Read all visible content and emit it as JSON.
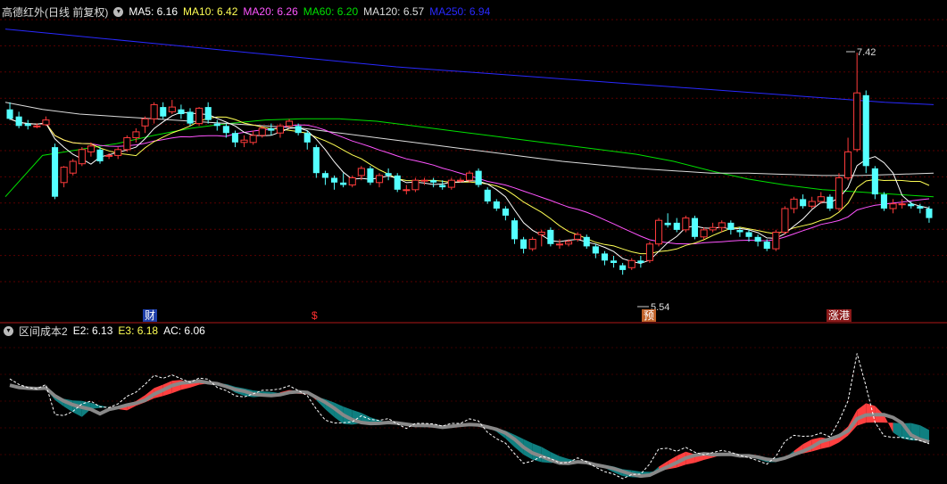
{
  "header": {
    "title": "高德红外(日线 前复权)",
    "ma": [
      {
        "label": "MA5: 6.16",
        "color": "#ffffff"
      },
      {
        "label": "MA10: 6.42",
        "color": "#ffff54"
      },
      {
        "label": "MA20: 6.26",
        "color": "#ff54ff"
      },
      {
        "label": "MA60: 6.20",
        "color": "#00e000"
      },
      {
        "label": "MA120: 6.57",
        "color": "#dddddd"
      },
      {
        "label": "MA250: 6.94",
        "color": "#2929ff"
      }
    ]
  },
  "indicator_header": {
    "title": "区间成本2",
    "items": [
      {
        "label": "E2: 6.13",
        "color": "#ffffff"
      },
      {
        "label": "E3: 6.18",
        "color": "#ffff54"
      },
      {
        "label": "AC: 6.06",
        "color": "#ffffff"
      }
    ]
  },
  "annotations": {
    "high": "7.42",
    "low": "5.54"
  },
  "markers": [
    {
      "text": "财",
      "bg": "#1f3fa8",
      "color": "#ffffff"
    },
    {
      "text": "$",
      "bg": "#000000",
      "color": "#ff3030"
    },
    {
      "text": "预",
      "bg": "#c0632a",
      "color": "#ffffff"
    },
    {
      "text": "涨港",
      "bg": "#8b1a1a",
      "color": "#ffffff"
    }
  ],
  "chart_data": {
    "type": "candlestick",
    "price_range": [
      5.3,
      7.7
    ],
    "candles": [
      [
        6.94,
        6.86,
        7.0,
        6.85
      ],
      [
        6.88,
        6.8,
        6.92,
        6.78
      ],
      [
        6.82,
        6.8,
        6.85,
        6.77
      ],
      [
        6.8,
        6.8,
        6.82,
        6.78
      ],
      [
        6.81,
        6.85,
        6.88,
        6.8
      ],
      [
        6.62,
        6.2,
        6.65,
        6.18
      ],
      [
        6.32,
        6.45,
        6.46,
        6.28
      ],
      [
        6.4,
        6.5,
        6.52,
        6.38
      ],
      [
        6.48,
        6.6,
        6.62,
        6.46
      ],
      [
        6.58,
        6.63,
        6.66,
        6.54
      ],
      [
        6.6,
        6.5,
        6.62,
        6.48
      ],
      [
        6.55,
        6.55,
        6.57,
        6.52
      ],
      [
        6.55,
        6.6,
        6.62,
        6.52
      ],
      [
        6.6,
        6.7,
        6.72,
        6.58
      ],
      [
        6.7,
        6.75,
        6.78,
        6.66
      ],
      [
        6.8,
        6.86,
        6.88,
        6.74
      ],
      [
        6.86,
        6.98,
        7.0,
        6.82
      ],
      [
        6.96,
        6.88,
        7.0,
        6.86
      ],
      [
        6.92,
        6.96,
        7.02,
        6.9
      ],
      [
        6.94,
        6.9,
        6.98,
        6.86
      ],
      [
        6.92,
        6.82,
        6.95,
        6.8
      ],
      [
        6.82,
        6.95,
        6.96,
        6.8
      ],
      [
        6.96,
        6.85,
        7.0,
        6.82
      ],
      [
        6.82,
        6.8,
        6.85,
        6.76
      ],
      [
        6.8,
        6.74,
        6.82,
        6.7
      ],
      [
        6.74,
        6.66,
        6.76,
        6.62
      ],
      [
        6.66,
        6.68,
        6.72,
        6.62
      ],
      [
        6.66,
        6.72,
        6.76,
        6.64
      ],
      [
        6.72,
        6.78,
        6.8,
        6.7
      ],
      [
        6.78,
        6.76,
        6.82,
        6.72
      ],
      [
        6.74,
        6.8,
        6.82,
        6.7
      ],
      [
        6.8,
        6.84,
        6.86,
        6.78
      ],
      [
        6.8,
        6.74,
        6.82,
        6.72
      ],
      [
        6.74,
        6.66,
        6.76,
        6.6
      ],
      [
        6.62,
        6.4,
        6.64,
        6.36
      ],
      [
        6.4,
        6.36,
        6.42,
        6.3
      ],
      [
        6.36,
        6.32,
        6.38,
        6.26
      ],
      [
        6.32,
        6.3,
        6.4,
        6.28
      ],
      [
        6.3,
        6.36,
        6.38,
        6.28
      ],
      [
        6.38,
        6.44,
        6.46,
        6.34
      ],
      [
        6.44,
        6.32,
        6.46,
        6.3
      ],
      [
        6.32,
        6.38,
        6.4,
        6.28
      ],
      [
        6.4,
        6.38,
        6.44,
        6.34
      ],
      [
        6.38,
        6.26,
        6.4,
        6.24
      ],
      [
        6.26,
        6.26,
        6.3,
        6.22
      ],
      [
        6.26,
        6.34,
        6.36,
        6.24
      ],
      [
        6.34,
        6.34,
        6.36,
        6.3
      ],
      [
        6.34,
        6.32,
        6.36,
        6.28
      ],
      [
        6.3,
        6.28,
        6.34,
        6.26
      ],
      [
        6.28,
        6.34,
        6.36,
        6.26
      ],
      [
        6.34,
        6.34,
        6.36,
        6.32
      ],
      [
        6.34,
        6.4,
        6.42,
        6.32
      ],
      [
        6.42,
        6.3,
        6.44,
        6.28
      ],
      [
        6.26,
        6.16,
        6.28,
        6.14
      ],
      [
        6.16,
        6.1,
        6.18,
        6.08
      ],
      [
        6.1,
        6.04,
        6.12,
        6.0
      ],
      [
        6.0,
        5.84,
        6.02,
        5.8
      ],
      [
        5.84,
        5.76,
        5.86,
        5.72
      ],
      [
        5.76,
        5.84,
        5.86,
        5.74
      ],
      [
        5.88,
        5.9,
        5.92,
        5.78
      ],
      [
        5.92,
        5.8,
        5.94,
        5.78
      ],
      [
        5.8,
        5.8,
        5.84,
        5.76
      ],
      [
        5.8,
        5.82,
        5.84,
        5.78
      ],
      [
        5.84,
        5.88,
        5.9,
        5.82
      ],
      [
        5.86,
        5.78,
        5.88,
        5.76
      ],
      [
        5.78,
        5.72,
        5.8,
        5.68
      ],
      [
        5.72,
        5.66,
        5.74,
        5.62
      ],
      [
        5.66,
        5.64,
        5.7,
        5.6
      ],
      [
        5.62,
        5.58,
        5.64,
        5.54
      ],
      [
        5.6,
        5.66,
        5.68,
        5.58
      ],
      [
        5.66,
        5.64,
        5.7,
        5.6
      ],
      [
        5.66,
        5.8,
        5.82,
        5.64
      ],
      [
        5.8,
        6.0,
        6.02,
        5.78
      ],
      [
        5.98,
        5.96,
        6.06,
        5.94
      ],
      [
        5.98,
        5.92,
        6.02,
        5.9
      ],
      [
        5.92,
        6.02,
        6.04,
        5.9
      ],
      [
        6.02,
        5.86,
        6.04,
        5.84
      ],
      [
        5.86,
        5.92,
        5.94,
        5.84
      ],
      [
        5.92,
        5.94,
        5.98,
        5.9
      ],
      [
        5.94,
        5.98,
        6.0,
        5.9
      ],
      [
        5.98,
        5.92,
        6.0,
        5.88
      ],
      [
        5.92,
        5.9,
        5.94,
        5.86
      ],
      [
        5.9,
        5.86,
        5.92,
        5.82
      ],
      [
        5.86,
        5.82,
        5.88,
        5.78
      ],
      [
        5.82,
        5.76,
        5.84,
        5.74
      ],
      [
        5.76,
        5.9,
        5.92,
        5.74
      ],
      [
        5.9,
        6.1,
        6.12,
        5.88
      ],
      [
        6.1,
        6.18,
        6.2,
        6.06
      ],
      [
        6.18,
        6.12,
        6.22,
        6.1
      ],
      [
        6.12,
        6.16,
        6.2,
        6.1
      ],
      [
        6.16,
        6.2,
        6.24,
        6.14
      ],
      [
        6.2,
        6.1,
        6.22,
        6.08
      ],
      [
        6.1,
        6.36,
        6.4,
        6.08
      ],
      [
        6.36,
        6.58,
        6.7,
        6.34
      ],
      [
        6.6,
        7.08,
        7.42,
        6.58
      ],
      [
        7.06,
        6.46,
        7.1,
        6.4
      ],
      [
        6.44,
        6.22,
        6.46,
        6.18
      ],
      [
        6.22,
        6.1,
        6.24,
        6.08
      ],
      [
        6.1,
        6.14,
        6.18,
        6.06
      ],
      [
        6.14,
        6.14,
        6.18,
        6.1
      ],
      [
        6.14,
        6.12,
        6.16,
        6.1
      ],
      [
        6.12,
        6.1,
        6.14,
        6.06
      ],
      [
        6.1,
        6.02,
        6.12,
        5.98
      ]
    ],
    "series": [
      {
        "name": "MA5",
        "color": "#ffffff",
        "values": []
      },
      {
        "name": "MA10",
        "color": "#ffff54",
        "values": []
      },
      {
        "name": "MA20",
        "color": "#ff54ff",
        "values": []
      },
      {
        "name": "MA60",
        "color": "#00e000",
        "values": [
          6.2,
          6.55,
          6.6,
          6.65,
          6.72,
          6.78,
          6.82,
          6.85,
          6.86,
          6.86,
          6.84,
          6.8,
          6.76,
          6.72,
          6.68,
          6.64,
          6.6,
          6.56,
          6.5,
          6.42,
          6.35,
          6.3,
          6.26,
          6.24,
          6.22,
          6.2
        ]
      },
      {
        "name": "MA120",
        "color": "#dddddd",
        "values": [
          7.0,
          6.94,
          6.9,
          6.88,
          6.86,
          6.84,
          6.82,
          6.8,
          6.78,
          6.74,
          6.7,
          6.66,
          6.62,
          6.58,
          6.54,
          6.5,
          6.47,
          6.44,
          6.42,
          6.4,
          6.4,
          6.39,
          6.38,
          6.38,
          6.39,
          6.4
        ]
      },
      {
        "name": "MA250",
        "color": "#2929ff",
        "values": [
          7.62,
          7.58,
          7.54,
          7.5,
          7.46,
          7.42,
          7.38,
          7.34,
          7.3,
          7.27,
          7.24,
          7.21,
          7.18,
          7.15,
          7.12,
          7.09,
          7.06,
          7.03,
          7.0,
          6.98
        ]
      }
    ]
  }
}
